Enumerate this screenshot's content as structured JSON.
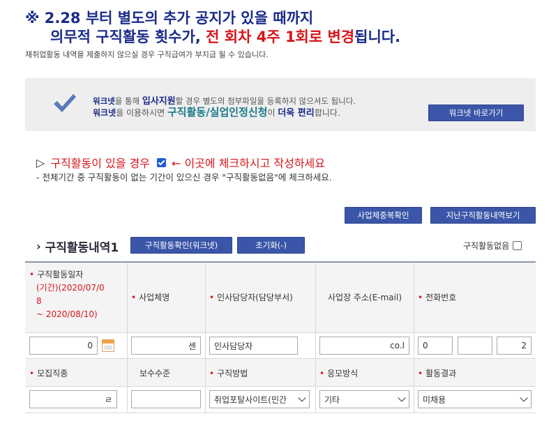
{
  "notice": {
    "line1": "※ 2.28 부터 별도의 추가 공지가 있을 때까지",
    "line2_prefix": "의무적 구직활동 횟수가, ",
    "line2_red": "전 회차 4주 1회로 변경",
    "line2_suffix": "됩니다.",
    "warning": "재취업활동 내역을 제출하지 않으실 경우 구직급여가 부지급 될 수 있습니다."
  },
  "info_box": {
    "icon": "checkmark-icon",
    "line1_bold": "워크넷",
    "line1_mid": "을 통해 ",
    "line1_bold2": "입사지원",
    "line1_end": "할 경우 별도의 첨부파일을 등록하지 않으셔도 됩니다.",
    "line2_bold": "워크넷",
    "line2_mid": "을 이용하시면 ",
    "line2_teal": "구직활동/실업인정신청",
    "line2_mid2": "이 ",
    "line2_bold2": "더욱 편리",
    "line2_end": "합니다.",
    "button": "워크넷 바로가기"
  },
  "guide": {
    "marker": "▷",
    "text_before": "구직활동이 있을 경우",
    "text_after": "← 이곳에 체크하시고 작성하세요",
    "sub": "- 전체기간 중 구직활동이 없는 기간이 있으신 경우 \"구직활동없음\"에 체크하세요."
  },
  "buttons": {
    "duplicate_check": "사업체중복확인",
    "past_history": "지난구직활동내역보기",
    "confirm_worknet": "구직활동확인(워크넷)",
    "reset": "초기화(-)"
  },
  "section": {
    "chevron": "›",
    "title": "구직활동내역1",
    "no_activity_label": "구직활동없음"
  },
  "table": {
    "required_mark": "•",
    "headers_row1": {
      "date": "구직활동일자",
      "period_line1": "(기간)(2020/07/0",
      "period_line2": "8",
      "period_line3": "~ 2020/08/10)",
      "company": "사업체명",
      "hr_contact": "인사담당자(담당부서)",
      "address": "사업장 주소(E-mail)",
      "phone": "전화번호"
    },
    "inputs_row1": {
      "date_value": "0",
      "company_value": "센",
      "hr_value": "인사담당자",
      "address_value": "co.l",
      "phone1": "0",
      "phone2": "",
      "phone3": "2"
    },
    "headers_row2": {
      "job_type": "모집직종",
      "salary": "보수수준",
      "method": "구직방법",
      "apply_method": "응모방식",
      "result": "활동결과"
    },
    "inputs_row2": {
      "job_type_value": "ㄹ",
      "salary_value": "",
      "method_value": "취업포탈사이트(민간",
      "apply_value": "기타",
      "result_value": "미채용"
    }
  },
  "colors": {
    "notice_navy": "#1a2a8a",
    "notice_red": "#d7141a",
    "button_blue": "#3b56a8",
    "info_bg": "#eeeeee"
  }
}
